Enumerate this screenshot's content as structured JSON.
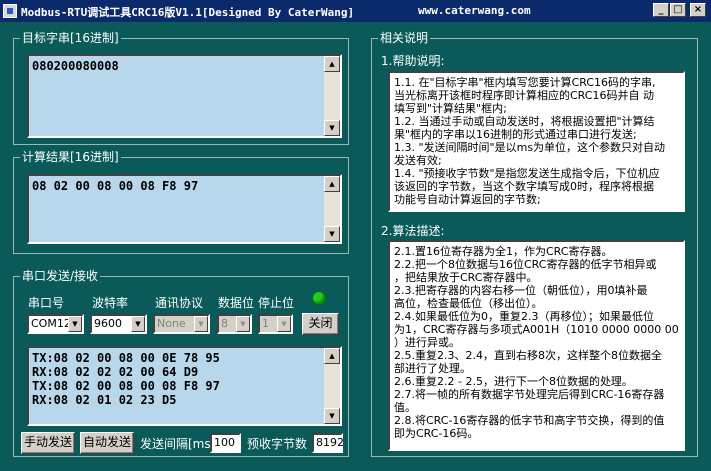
{
  "window": {
    "title": "Modbus-RTU调试工具CRC16版V1.1[Designed By CaterWang]",
    "url": "www.caterwang.com",
    "minimize": "_",
    "maximize": "□",
    "close": "×"
  },
  "target_group": {
    "title": "目标字串[16进制]",
    "lines": [
      "080200080008"
    ]
  },
  "result_group": {
    "title": "计算结果[16进制]",
    "lines": [
      "08 02 00 08 00 08 F8 97"
    ]
  },
  "serial_group": {
    "title": "串口发送/接收",
    "labels": {
      "port": "串口号",
      "baud": "波特率",
      "protocol": "通讯协议",
      "databits": "数据位",
      "stopbits": "停止位"
    },
    "port_value": "COM12",
    "baud_value": "9600",
    "protocol_value": "None",
    "databits_value": "8",
    "stopbits_value": "1",
    "close_button": "关闭",
    "status_led_color": "#22cc22",
    "log_lines": [
      "TX:08 02 00 08 00 0E 78 95",
      "RX:08 02 02 02 00 64 D9",
      "TX:08 02 00 08 00 08 F8 97",
      "RX:08 02 01 02 23 D5"
    ],
    "manual_send": "手动发送",
    "auto_send": "自动发送",
    "interval_label": "发送间隔[ms]",
    "interval_value": "100",
    "predict_label": "预收字节数",
    "predict_value": "8192"
  },
  "about_group": {
    "title": "相关说明",
    "help_heading": "1.帮助说明:",
    "help_lines": [
      "1.1. 在\"目标字串\"框内填写您要计算CRC16码的字串,",
      "当光标离开该框时程序即计算相应的CRC16码并自 动",
      "填写到\"计算结果\"框内;",
      "1.2. 当通过手动或自动发送时，将根据设置把\"计算结",
      "果\"框内的字串以16进制的形式通过串口进行发送;",
      "1.3. \"发送间隔时间\"是以ms为单位，这个参数只对自动",
      "发送有效;",
      "1.4. \"预接收字节数\"是指您发送生成指令后，下位机应",
      "该返回的字节数，当这个数字填写成0时，程序将根据",
      "功能号自动计算返回的字节数;"
    ],
    "algo_heading": "2.算法描述:",
    "algo_lines": [
      "2.1.置16位寄存器为全1，作为CRC寄存器。",
      "2.2.把一个8位数据与16位CRC寄存器的低字节相异或",
      "，把结果放于CRC寄存器中。",
      "2.3.把寄存器的内容右移一位（朝低位），用0填补最",
      "高位，检查最低位（移出位）。",
      "2.4.如果最低位为0，重复2.3（再移位）；如果最低位",
      "为1，CRC寄存器与多项式A001H（1010 0000 0000 0001",
      "）进行异或。",
      "2.5.重复2.3、2.4，直到右移8次，这样整个8位数据全",
      "部进行了处理。",
      "2.6.重复2.2 - 2.5，进行下一个8位数据的处理。",
      "2.7.将一帧的所有数据字节处理完后得到CRC-16寄存器",
      "值。",
      "2.8.将CRC-16寄存器的低字节和高字节交换，得到的值",
      "即为CRC-16码。"
    ]
  }
}
